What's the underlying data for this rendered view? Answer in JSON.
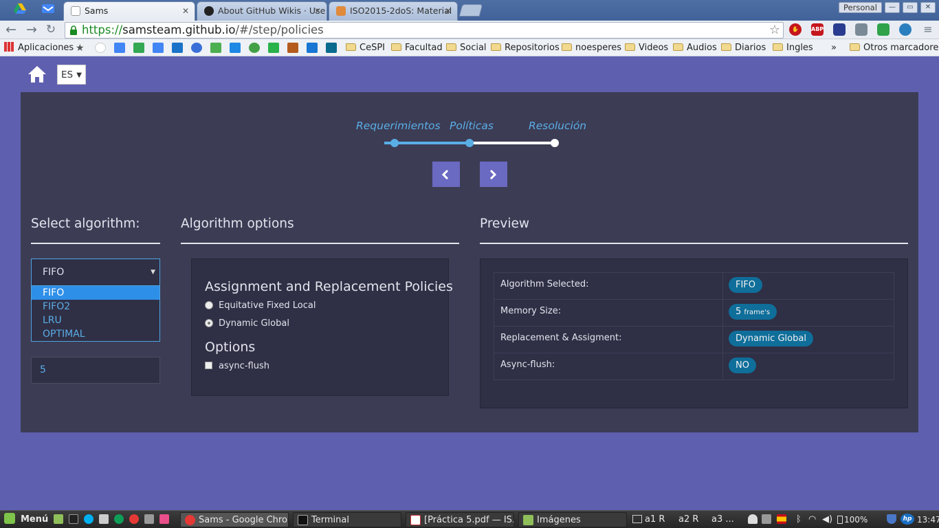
{
  "browser": {
    "tabs": [
      {
        "title": "Sams",
        "active": true
      },
      {
        "title": "About GitHub Wikis · Use",
        "active": false
      },
      {
        "title": "ISO2015-2doS: Material",
        "active": false
      }
    ],
    "profile": "Personal",
    "url_scheme": "https://",
    "url_host": "samsteam.github.io",
    "url_path": "/#/step/policies",
    "bookmarks": {
      "apps": "Aplicaciones",
      "folders": [
        "CeSPI",
        "Facultad",
        "Social",
        "Repositorios",
        "noesperes",
        "Videos",
        "Audios",
        "Diarios",
        "Ingles"
      ],
      "more": "»",
      "other": "Otros marcadores"
    }
  },
  "app": {
    "language": "ES",
    "steps": [
      {
        "label": "Requerimientos",
        "state": "done"
      },
      {
        "label": "Políticas",
        "state": "current"
      },
      {
        "label": "Resolución",
        "state": "pending"
      }
    ],
    "colors": {
      "accent": "#5aaee6",
      "panel": "#3c3c55",
      "page": "#5f5fb0",
      "badge": "#0f6e9a"
    },
    "algorithm": {
      "title": "Select algorithm:",
      "selected": "FIFO",
      "options": [
        "FIFO",
        "FIFO2",
        "LRU",
        "OPTIMAL"
      ],
      "memory_size": "5"
    },
    "options": {
      "title": "Algorithm options",
      "policies_heading": "Assignment and Replacement Policies",
      "policies": [
        {
          "label": "Equitative Fixed Local",
          "checked": false
        },
        {
          "label": "Dynamic Global",
          "checked": true
        }
      ],
      "options_heading": "Options",
      "async_flush_label": "async-flush",
      "async_flush_checked": false
    },
    "preview": {
      "title": "Preview",
      "rows": [
        {
          "key": "Algorithm Selected:",
          "value": "FIFO"
        },
        {
          "key": "Memory Size:",
          "value": "5",
          "unit": "frame's"
        },
        {
          "key": "Replacement & Assigment:",
          "value": "Dynamic Global"
        },
        {
          "key": "Async-flush:",
          "value": "NO"
        }
      ]
    }
  },
  "taskbar": {
    "menu": "Menú",
    "windows": [
      "Sams - Google Chrome",
      "Terminal",
      "[Práctica 5.pdf — IS...",
      "Imágenes"
    ],
    "workspaces": [
      "a1 R",
      "a2 R",
      "a3 ..."
    ],
    "battery": "100%",
    "clock": "13:47"
  }
}
